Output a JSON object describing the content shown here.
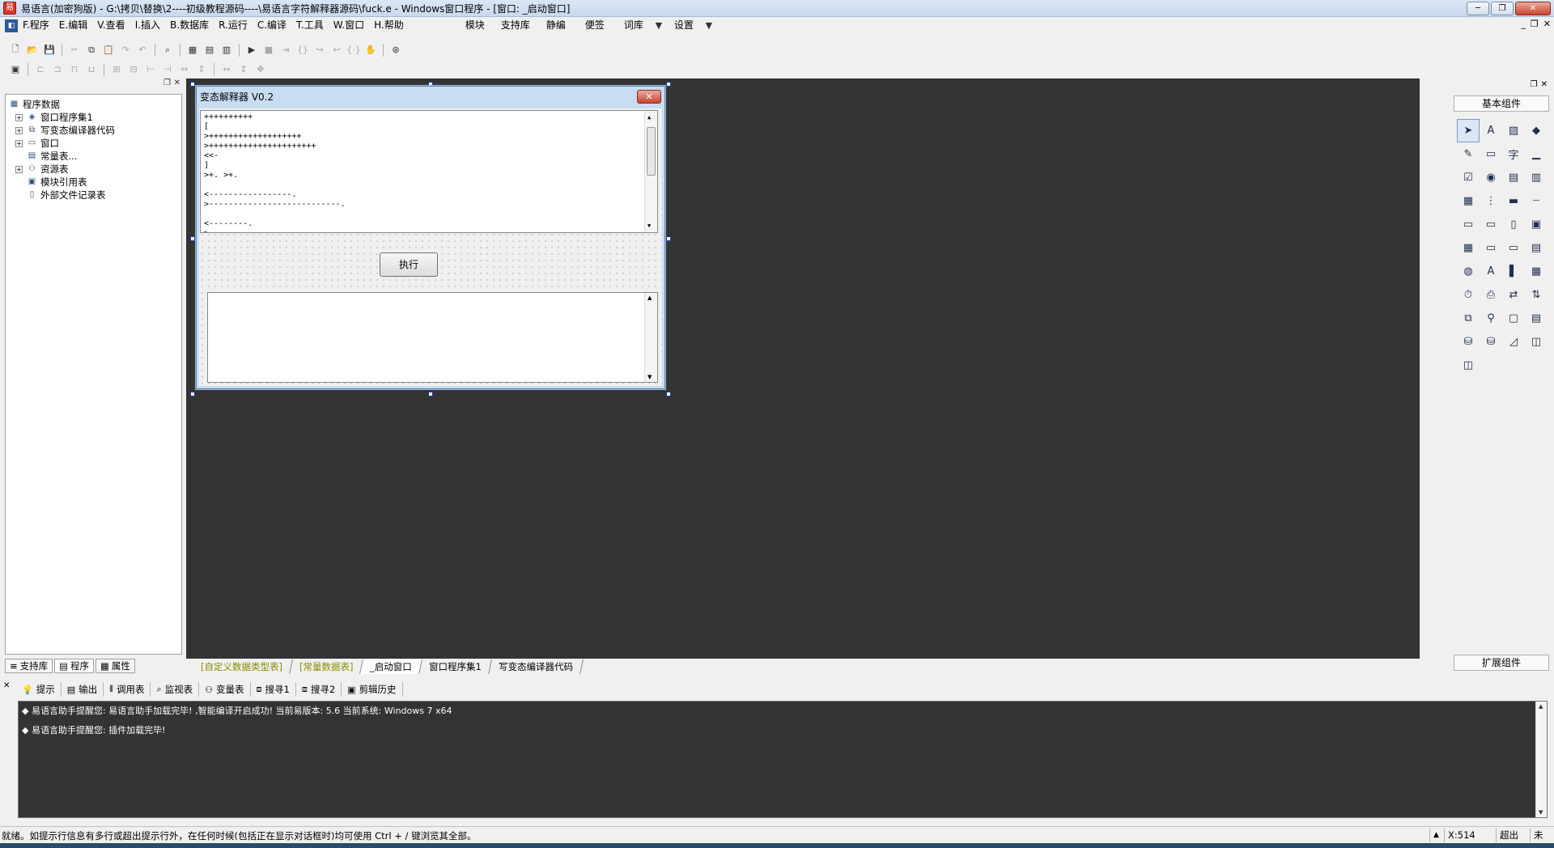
{
  "window": {
    "title": "易语言(加密狗版) - G:\\拷贝\\替换\\2----初级教程源码----\\易语言字符解释器源码\\fuck.e - Windows窗口程序 - [窗口: _启动窗口]",
    "min": "─",
    "restore": "❐",
    "close": "✕"
  },
  "menu": {
    "items": [
      {
        "key": "F",
        "label": "F.程序"
      },
      {
        "key": "E",
        "label": "E.编辑"
      },
      {
        "key": "V",
        "label": "V.查看"
      },
      {
        "key": "I",
        "label": "I.插入"
      },
      {
        "key": "B",
        "label": "B.数据库"
      },
      {
        "key": "R",
        "label": "R.运行"
      },
      {
        "key": "C",
        "label": "C.编译"
      },
      {
        "key": "T",
        "label": "T.工具"
      },
      {
        "key": "W",
        "label": "W.窗口"
      },
      {
        "key": "H",
        "label": "H.帮助"
      }
    ],
    "extra": [
      "模块",
      "支持库",
      "静编",
      "便签",
      "词库",
      "设置"
    ]
  },
  "tree": {
    "root": "程序数据",
    "items": [
      {
        "label": "窗口程序集1",
        "expander": "+"
      },
      {
        "label": "写变态编译器代码",
        "expander": "+"
      },
      {
        "label": "窗口",
        "expander": "+"
      },
      {
        "label": "常量表...",
        "expander": ""
      },
      {
        "label": "资源表",
        "expander": "+"
      },
      {
        "label": "模块引用表",
        "expander": ""
      },
      {
        "label": "外部文件记录表",
        "expander": ""
      }
    ]
  },
  "left_tabs": [
    "支持库",
    "程序",
    "属性"
  ],
  "form": {
    "title": "变态解释器 V0.2",
    "close": "✕",
    "code_lines": [
      "++++++++++",
      "[",
      ">+++++++++++++++++++",
      ">++++++++++++++++++++++",
      "<<-",
      "]",
      ">+. >+.",
      "",
      "<-----------------.",
      ">---------------------------.",
      "",
      "<--------.",
      ">-----------------------------------------------."
    ],
    "button": "执行"
  },
  "doc_tabs": [
    {
      "label": "[自定义数据类型表]",
      "style": "olive"
    },
    {
      "label": "[常量数据表]",
      "style": "olive"
    },
    {
      "label": "_启动窗口",
      "style": "active"
    },
    {
      "label": "窗口程序集1",
      "style": "normal"
    },
    {
      "label": "写变态编译器代码",
      "style": "normal"
    }
  ],
  "right_panel": {
    "header": "基本组件",
    "footer": "扩展组件",
    "tool_icons": [
      "pointer-icon",
      "label-icon",
      "picture-icon",
      "shape-icon",
      "edit-icon",
      "groupbox-icon",
      "text-icon",
      "line-icon",
      "checkbox-icon",
      "radio-icon",
      "combobox-icon",
      "listbox-icon",
      "listview-icon",
      "scroll-icon",
      "slider-icon",
      "ruler-icon",
      "progress-icon",
      "tab-icon",
      "frame-icon",
      "image-icon",
      "calendar-icon",
      "dir-icon",
      "drive-icon",
      "file-icon",
      "color-icon",
      "font-icon",
      "split-icon",
      "grid-icon",
      "timer-icon",
      "printer-icon",
      "link-icon",
      "link2-icon",
      "net-icon",
      "filter-icon",
      "panel-icon",
      "toolbar-icon",
      "db-icon",
      "db2-icon",
      "chart-icon",
      "odbc-icon",
      "odbc2-icon"
    ]
  },
  "bottom_tabs": [
    "提示",
    "输出",
    "调用表",
    "监视表",
    "变量表",
    "搜寻1",
    "搜寻2",
    "剪辑历史"
  ],
  "output": {
    "line1_text": "易语言助手提醒您: 易语言助手加载完毕! ,智能编译开启成功! 当前易版本: 5.6 当前系统: Windows 7 x64",
    "line2_text": "易语言助手提醒您: 插件加载完毕!"
  },
  "status": {
    "message": "就绪。如提示行信息有多行或超出提示行外，在任何时候(包括正在显示对话框时)均可使用 Ctrl + / 键浏览其全部。",
    "x": "X:514",
    "mode": "超出",
    "state": "未改"
  }
}
